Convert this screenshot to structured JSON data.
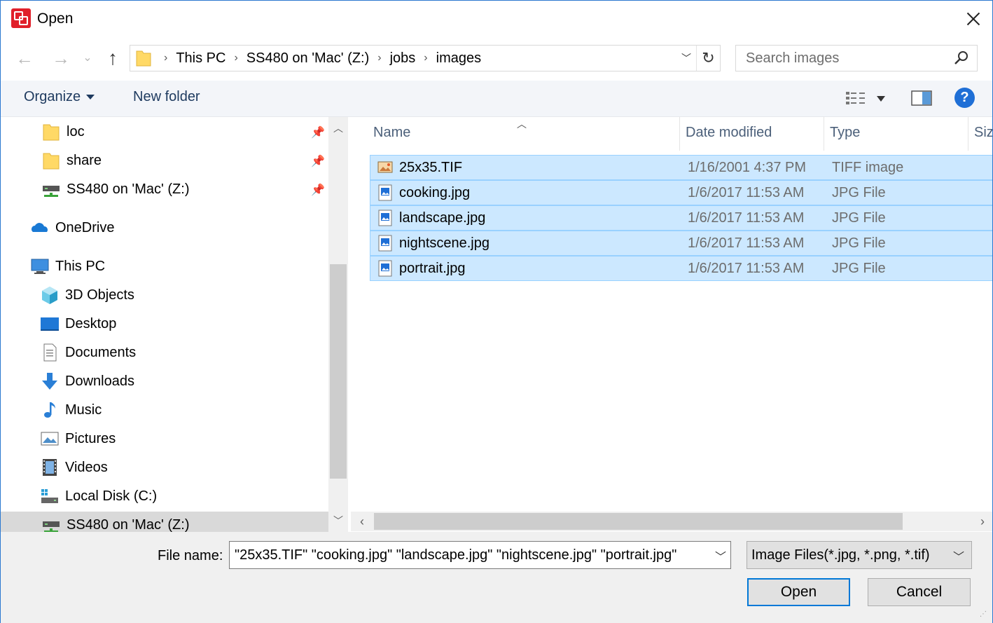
{
  "window": {
    "title": "Open"
  },
  "address": {
    "crumbs": [
      "This PC",
      "SS480 on 'Mac' (Z:)",
      "jobs",
      "images"
    ],
    "search_placeholder": "Search images"
  },
  "commandbar": {
    "organize": "Organize",
    "new_folder": "New folder",
    "help": "?"
  },
  "nav": {
    "items": [
      {
        "label": "loc",
        "icon": "folder-icon",
        "pinned": true
      },
      {
        "label": "share",
        "icon": "folder-icon",
        "pinned": true
      },
      {
        "label": "SS480 on 'Mac' (Z:)",
        "icon": "network-drive-icon",
        "pinned": true
      },
      {
        "label": "OneDrive",
        "icon": "onedrive-icon"
      },
      {
        "label": "This PC",
        "icon": "computer-icon"
      },
      {
        "label": "3D Objects",
        "icon": "3d-objects-icon"
      },
      {
        "label": "Desktop",
        "icon": "desktop-icon"
      },
      {
        "label": "Documents",
        "icon": "documents-icon"
      },
      {
        "label": "Downloads",
        "icon": "downloads-icon"
      },
      {
        "label": "Music",
        "icon": "music-icon"
      },
      {
        "label": "Pictures",
        "icon": "pictures-icon"
      },
      {
        "label": "Videos",
        "icon": "videos-icon"
      },
      {
        "label": "Local Disk (C:)",
        "icon": "local-disk-icon"
      },
      {
        "label": "SS480 on 'Mac' (Z:)",
        "icon": "network-drive-icon",
        "selected": true
      }
    ]
  },
  "filelist": {
    "columns": [
      "Name",
      "Date modified",
      "Type",
      "Siz"
    ],
    "files": [
      {
        "name": "25x35.TIF",
        "date": "1/16/2001 4:37 PM",
        "type": "TIFF image",
        "icon": "tiff-image-icon"
      },
      {
        "name": "cooking.jpg",
        "date": "1/6/2017 11:53 AM",
        "type": "JPG File",
        "icon": "jpg-file-icon"
      },
      {
        "name": "landscape.jpg",
        "date": "1/6/2017 11:53 AM",
        "type": "JPG File",
        "icon": "jpg-file-icon"
      },
      {
        "name": "nightscene.jpg",
        "date": "1/6/2017 11:53 AM",
        "type": "JPG File",
        "icon": "jpg-file-icon"
      },
      {
        "name": "portrait.jpg",
        "date": "1/6/2017 11:53 AM",
        "type": "JPG File",
        "icon": "jpg-file-icon"
      }
    ]
  },
  "footer": {
    "filename_label": "File name:",
    "filename_value": "\"25x35.TIF\" \"cooking.jpg\" \"landscape.jpg\" \"nightscene.jpg\" \"portrait.jpg\"",
    "filter_value": "Image Files(*.jpg, *.png, *.tif)",
    "open_label": "Open",
    "cancel_label": "Cancel"
  },
  "colors": {
    "accent": "#0078d7",
    "selection": "#cce8ff",
    "selection_border": "#99d1ff",
    "app_icon": "#e0202a"
  }
}
